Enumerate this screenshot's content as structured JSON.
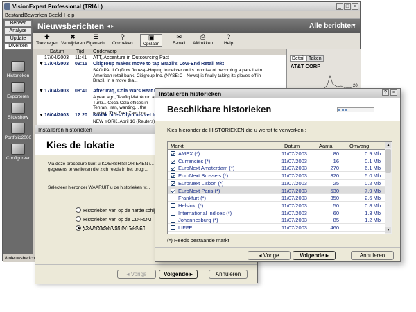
{
  "main": {
    "title": "VisionExpert Professional (TRIAL)",
    "menu": [
      "Bestand",
      "Bewerken",
      "Beeld",
      "Help"
    ],
    "sidebar": {
      "tabs": [
        "Beheer",
        "Analyse",
        "Update",
        "Diversen"
      ],
      "items": [
        "Historieken",
        "Exporteren",
        "Slideshow",
        "Portfolio2000",
        "Configureer"
      ]
    },
    "header_title": "Nieuwsberichten",
    "header_right": "Alle berichten",
    "toolbar": [
      "Toevoegen",
      "Verwijderen",
      "Eigensch.",
      "Opzoeken",
      "Opslaan",
      "E-mail",
      "Afdrukken",
      "Help"
    ],
    "columns": [
      "Datum",
      "Tijd",
      "Onderwerp"
    ],
    "news": [
      {
        "date": "17/04/2003",
        "time": "11:41",
        "headline": "ATT, Accenture in Outsourcing Pact",
        "body": ""
      },
      {
        "date": "17/04/2003",
        "time": "09:15",
        "headline": "Citigroup makes move to tap Brazil's Low-End Retail Mkt",
        "body": "SAO PAULO (Dow Jones)--Hoping to deliver on its promise of becoming a pan- Latin American retail bank, Citigroup Inc. (NYSE:C - News) is finally taking its gloves off in Brazil. In a move tha..."
      },
      {
        "date": "17/04/2003",
        "time": "08:40",
        "headline": "After Iraq, Cola Wars Heat Up",
        "body": "A year ago, Tawfiq Mathkour, a Turki... Coca-Cola offices in Tehran, Iran, wanting... the market. The Zam-Zam bra..."
      },
      {
        "date": "16/04/2003",
        "time": "12:20",
        "headline": "Kodak hires Olympus vet to d...",
        "body": "NEW YORK, April 16 (Reuters) - Ea... ...ed Olympus' camera bu... ...hired a top..."
      }
    ],
    "right_tabs": [
      "Detail",
      "Taken"
    ],
    "right_title": "AT&T CORP",
    "right_axis": "20",
    "status": "8 nieuwsberichten"
  },
  "dialog1": {
    "title": "Installeren historieken",
    "heading": "Kies de lokatie",
    "text1": "Via deze procedure kunt u KOERSHISTORIEKEN i... gegevens te verliezen die zich reeds in het progr...",
    "text2": "Selecteer hieronder WAARUIT u de historieken w...",
    "options": [
      "Historieken van op de harde schijf",
      "Historieken van op de CD-ROM",
      "Downloaden van INTERNET"
    ],
    "selected_option": 2,
    "back_label": "Vorige",
    "next_label": "Volgende",
    "cancel_label": "Annuleren"
  },
  "dialog2": {
    "title": "Installeren historieken",
    "heading": "Beschikbare historieken",
    "instruction": "Kies hieronder de HISTORIEKEN die u wenst te verwerken :",
    "columns": [
      "Markt",
      "Datum",
      "Aantal",
      "Omvang"
    ],
    "rows": [
      {
        "market": "AMEX (*)",
        "date": "11/07/2003",
        "count": "80",
        "size": "0.9 Mb",
        "checked": true
      },
      {
        "market": "Currencies (*)",
        "date": "11/07/2003",
        "count": "16",
        "size": "0.1 Mb",
        "checked": true
      },
      {
        "market": "EuroNext Amsterdam (*)",
        "date": "11/07/2003",
        "count": "270",
        "size": "6.1 Mb",
        "checked": true
      },
      {
        "market": "EuroNext Brussels (*)",
        "date": "11/07/2003",
        "count": "320",
        "size": "5.0 Mb",
        "checked": true
      },
      {
        "market": "EuroNext Lisbon (*)",
        "date": "11/07/2003",
        "count": "25",
        "size": "0.2 Mb",
        "checked": true
      },
      {
        "market": "EuroNext Paris (*)",
        "date": "11/07/2003",
        "count": "530",
        "size": "7.9 Mb",
        "checked": true,
        "selected": true
      },
      {
        "market": "Frankfurt (*)",
        "date": "11/07/2003",
        "count": "350",
        "size": "2.6 Mb",
        "checked": false
      },
      {
        "market": "Helsinki (*)",
        "date": "11/07/2003",
        "count": "50",
        "size": "0.8 Mb",
        "checked": false
      },
      {
        "market": "International Indices (*)",
        "date": "11/07/2003",
        "count": "60",
        "size": "1.3 Mb",
        "checked": false
      },
      {
        "market": "Johannesburg (*)",
        "date": "11/07/2003",
        "count": "85",
        "size": "1.2 Mb",
        "checked": false
      },
      {
        "market": "LIFFE",
        "date": "11/07/2003",
        "count": "460",
        "size": "",
        "checked": false
      }
    ],
    "note": "(*) Reeds bestaande markt",
    "back_label": "Vorige",
    "next_label": "Volgende",
    "cancel_label": "Annuleren",
    "help_label": "?",
    "close_label": "×"
  },
  "colors": {
    "header_gray": "#6b6b6b",
    "link_blue": "#1a2f8a",
    "dialog_bg": "#ece9d8"
  }
}
